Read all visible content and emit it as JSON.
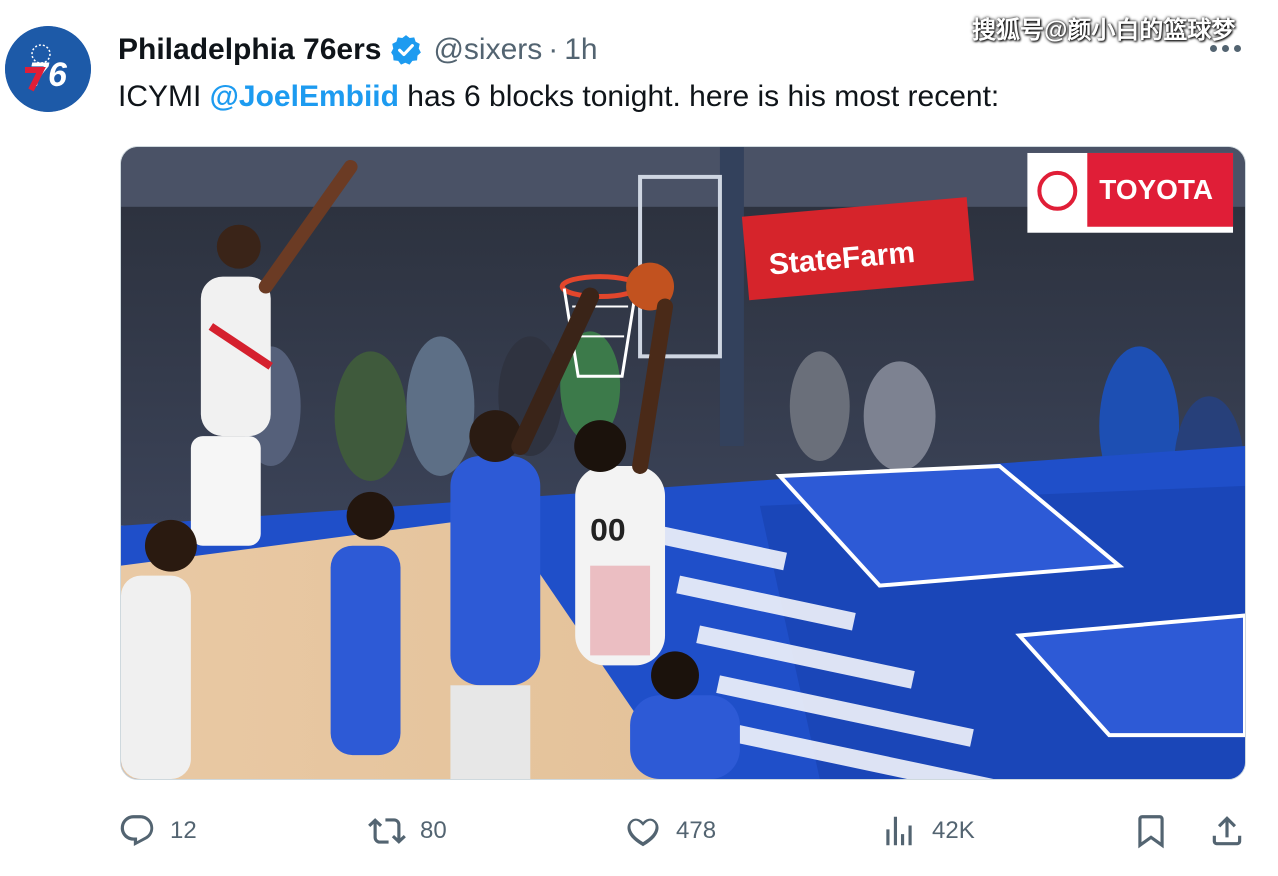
{
  "tweet": {
    "author": {
      "display_name": "Philadelphia 76ers",
      "handle": "@sixers",
      "time": "1h",
      "avatar_text": "76",
      "avatar_icon": "sixers-logo-icon",
      "verified_icon": "verified-badge-icon"
    },
    "text": {
      "prefix": "ICYMI ",
      "mention": "@JoelEmbiid",
      "suffix": " has 6 blocks tonight. here is his most recent:"
    },
    "media": {
      "alt": "Embiid block video still",
      "jersey_number": "00",
      "sign_state_farm": "StateFarm",
      "sign_toyota": "TOYOTA"
    },
    "metrics": {
      "replies": "12",
      "retweets": "80",
      "likes": "478",
      "views": "42K"
    }
  },
  "watermark": "搜狐号@颜小白的篮球梦",
  "colors": {
    "link": "#1d9bf0",
    "secondary": "#536471",
    "sixers_blue": "#1d5aa8",
    "sixers_red": "#e01e37"
  },
  "icons": [
    "reply-icon",
    "retweet-icon",
    "like-icon",
    "views-icon",
    "bookmark-icon",
    "share-icon",
    "more-icon"
  ]
}
